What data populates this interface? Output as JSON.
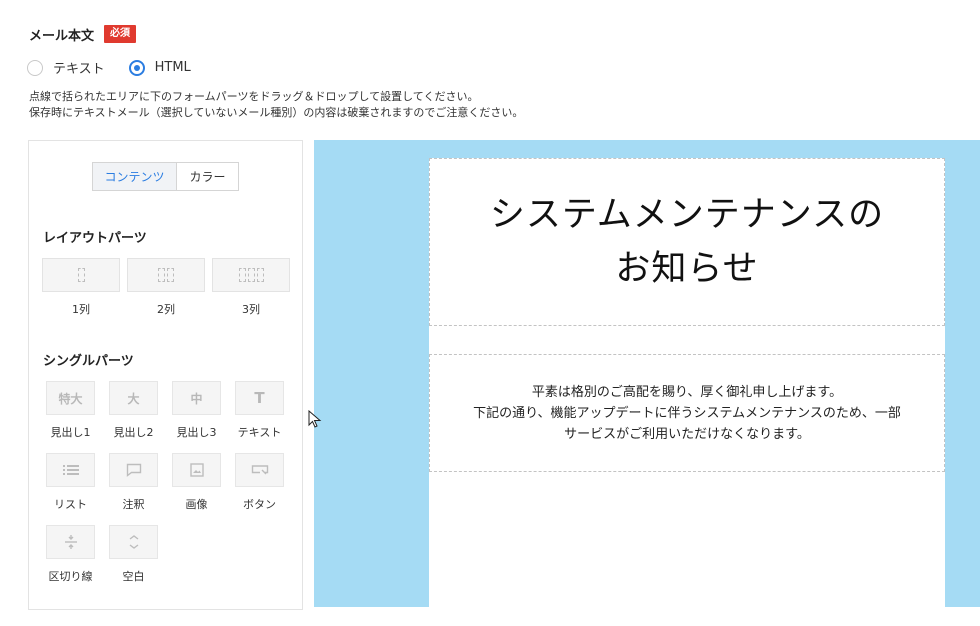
{
  "field": {
    "label": "メール本文",
    "required_badge": "必須"
  },
  "format": {
    "options": [
      {
        "label": "テキスト",
        "checked": false
      },
      {
        "label": "HTML",
        "checked": true
      }
    ]
  },
  "help": {
    "line1": "点線で括られたエリアに下のフォームパーツをドラッグ＆ドロップして設置してください。",
    "line2": "保存時にテキストメール（選択していないメール種別）の内容は破棄されますのでご注意ください。"
  },
  "palette": {
    "tabs": [
      {
        "label": "コンテンツ",
        "active": true
      },
      {
        "label": "カラー",
        "active": false
      }
    ],
    "layout_section": "レイアウトパーツ",
    "layout_parts": [
      {
        "label": "1列",
        "cols": 1
      },
      {
        "label": "2列",
        "cols": 2
      },
      {
        "label": "3列",
        "cols": 3
      }
    ],
    "single_section": "シングルパーツ",
    "single_parts": [
      {
        "label": "見出し1",
        "icon_text": "特大",
        "icon": "heading-xl-icon"
      },
      {
        "label": "見出し2",
        "icon_text": "大",
        "icon": "heading-l-icon"
      },
      {
        "label": "見出し3",
        "icon_text": "中",
        "icon": "heading-m-icon"
      },
      {
        "label": "テキスト",
        "icon_text": "T",
        "icon": "text-icon"
      },
      {
        "label": "リスト",
        "icon": "list-icon"
      },
      {
        "label": "注釈",
        "icon": "comment-icon"
      },
      {
        "label": "画像",
        "icon": "image-icon"
      },
      {
        "label": "ボタン",
        "icon": "button-icon"
      },
      {
        "label": "区切り線",
        "icon": "divider-icon"
      },
      {
        "label": "空白",
        "icon": "spacer-icon"
      }
    ]
  },
  "canvas": {
    "background": "#a5dbf4",
    "title_line1": "システムメンテナンスの",
    "title_line2": "お知らせ",
    "body_line1": "平素は格別のご高配を賜り、厚く御礼申し上げます。",
    "body_line2": "下記の通り、機能アップデートに伴うシステムメンテナンスのため、一部",
    "body_line3": "サービスがご利用いただけなくなります。"
  },
  "colors": {
    "accent": "#2b7de1",
    "required": "#e03a2f"
  }
}
